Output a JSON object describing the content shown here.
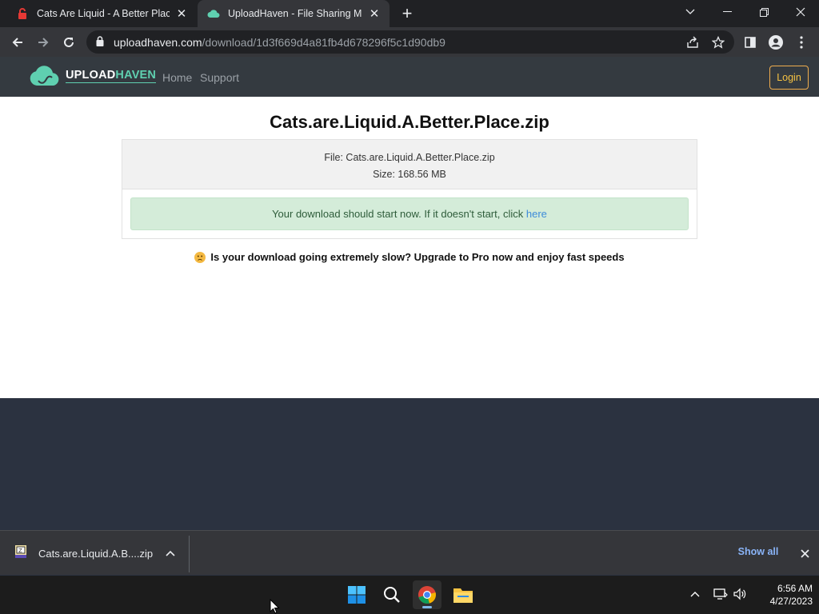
{
  "browser": {
    "tabs": [
      {
        "title": "Cats Are Liquid - A Better Place F",
        "active": false
      },
      {
        "title": "UploadHaven - File Sharing Made",
        "active": true
      }
    ],
    "url_domain": "uploadhaven.com",
    "url_path": "/download/1d3f669d4a81fb4d678296f5c1d90db9"
  },
  "site": {
    "logo_part1": "UPLOAD",
    "logo_part2": "HAVEN",
    "nav": {
      "home": "Home",
      "support": "Support"
    },
    "login": "Login"
  },
  "download": {
    "title": "Cats.are.Liquid.A.Better.Place.zip",
    "file_line": "File: Cats.are.Liquid.A.Better.Place.zip",
    "size_line": "Size: 168.56 MB",
    "alert_text": "Your download should start now. If it doesn't start, click ",
    "alert_link": "here",
    "slow_text": "Is your download going extremely slow? Upgrade to Pro now and enjoy fast speeds"
  },
  "download_bar": {
    "filename": "Cats.are.Liquid.A.B....zip",
    "show_all": "Show all"
  },
  "taskbar": {
    "time": "6:56 AM",
    "date": "4/27/2023"
  },
  "colors": {
    "accent": "#5fd0b0",
    "login_border": "#f0ad4e",
    "alert_bg": "#d4ecd9",
    "link": "#3d8bd9"
  }
}
